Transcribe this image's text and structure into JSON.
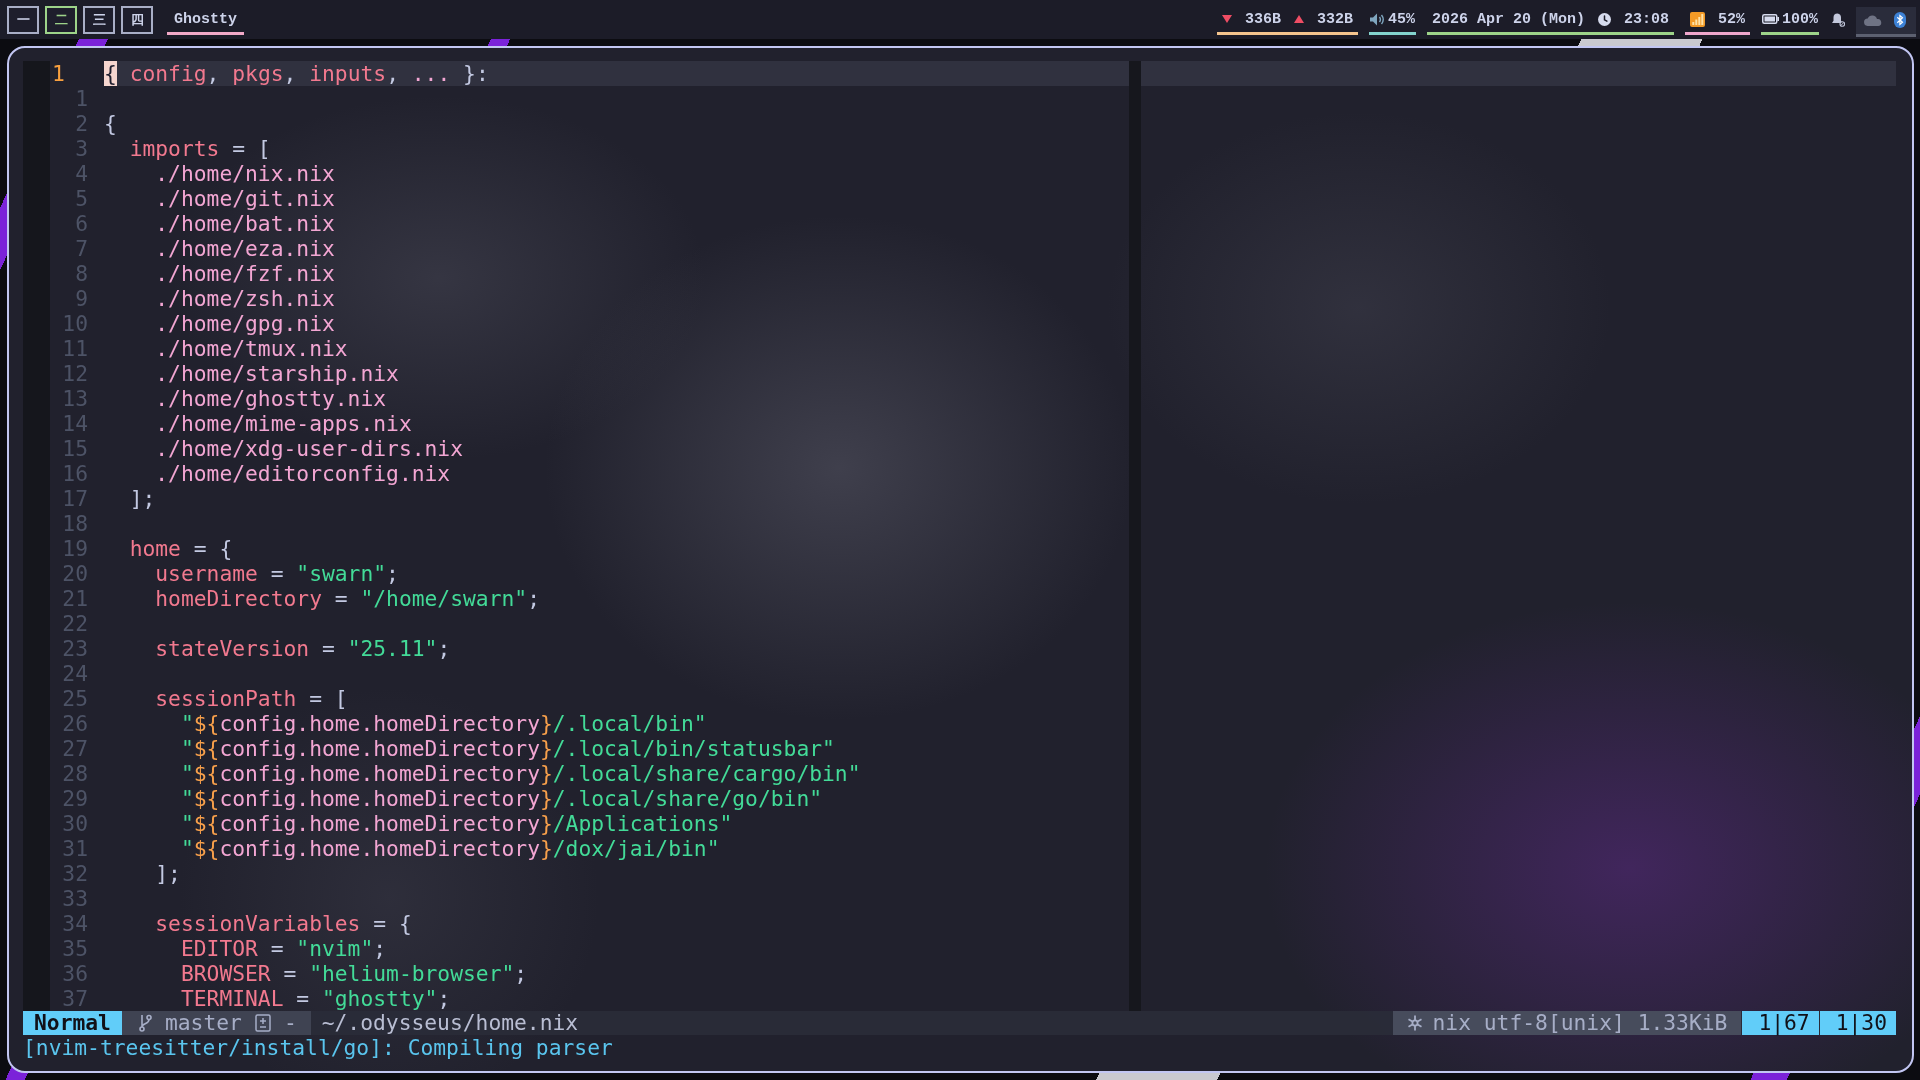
{
  "top_bar": {
    "workspaces": [
      {
        "label": "一",
        "selected": false
      },
      {
        "label": "二",
        "selected": true
      },
      {
        "label": "三",
        "selected": false
      },
      {
        "label": "四",
        "selected": false
      }
    ],
    "window_title": "Ghostty",
    "modules": [
      {
        "kind": "network",
        "down": "336B",
        "up": "332B",
        "color": "#f4c48e"
      },
      {
        "kind": "volume",
        "text": "45%",
        "color": "#83d3cd"
      },
      {
        "kind": "clock",
        "date": "2026 Apr 20 (Mon)",
        "time": "23:08",
        "color": "#9dd389"
      },
      {
        "kind": "signal",
        "text": "52%",
        "color": "#efa6cc"
      },
      {
        "kind": "battery",
        "text": "100%",
        "color": "#9dd389"
      },
      {
        "kind": "notifications"
      },
      {
        "kind": "tray"
      }
    ]
  },
  "editor": {
    "lines": [
      {
        "number": "1",
        "current": true,
        "tokens": [
          {
            "kind": "cursor",
            "text": "{"
          },
          {
            "kind": "attribute",
            "text": " config"
          },
          {
            "kind": "punctuation",
            "text": ", "
          },
          {
            "kind": "attribute",
            "text": "pkgs"
          },
          {
            "kind": "punctuation",
            "text": ", "
          },
          {
            "kind": "attribute",
            "text": "inputs"
          },
          {
            "kind": "punctuation",
            "text": ", "
          },
          {
            "kind": "variable",
            "text": "..."
          },
          {
            "kind": "punctuation",
            "text": " }:"
          }
        ]
      },
      {
        "number": "1",
        "current": false
      },
      {
        "number": "2",
        "current": false,
        "tokens": [
          {
            "kind": "punctuation",
            "text": "{"
          }
        ],
        "children": [
          {
            "number": "3",
            "current": false,
            "tokens": [
              {
                "kind": "attribute",
                "text": "imports"
              },
              {
                "kind": "punctuation",
                "text": " = ["
              }
            ],
            "children": [
              {
                "number": "4",
                "current": false,
                "tokens": [
                  {
                    "kind": "path",
                    "text": "./home/nix.nix"
                  }
                ]
              },
              {
                "number": "5",
                "current": false,
                "tokens": [
                  {
                    "kind": "path",
                    "text": "./home/git.nix"
                  }
                ]
              },
              {
                "number": "6",
                "current": false,
                "tokens": [
                  {
                    "kind": "path",
                    "text": "./home/bat.nix"
                  }
                ]
              },
              {
                "number": "7",
                "current": false,
                "tokens": [
                  {
                    "kind": "path",
                    "text": "./home/eza.nix"
                  }
                ]
              },
              {
                "number": "8",
                "current": false,
                "tokens": [
                  {
                    "kind": "path",
                    "text": "./home/fzf.nix"
                  }
                ]
              },
              {
                "number": "9",
                "current": false,
                "tokens": [
                  {
                    "kind": "path",
                    "text": "./home/zsh.nix"
                  }
                ]
              },
              {
                "number": "10",
                "current": false,
                "tokens": [
                  {
                    "kind": "path",
                    "text": "./home/gpg.nix"
                  }
                ]
              },
              {
                "number": "11",
                "current": false,
                "tokens": [
                  {
                    "kind": "path",
                    "text": "./home/tmux.nix"
                  }
                ]
              },
              {
                "number": "12",
                "current": false,
                "tokens": [
                  {
                    "kind": "path",
                    "text": "./home/starship.nix"
                  }
                ]
              },
              {
                "number": "13",
                "current": false,
                "tokens": [
                  {
                    "kind": "path",
                    "text": "./home/ghostty.nix"
                  }
                ]
              },
              {
                "number": "14",
                "current": false,
                "tokens": [
                  {
                    "kind": "path",
                    "text": "./home/mime-apps.nix"
                  }
                ]
              },
              {
                "number": "15",
                "current": false,
                "tokens": [
                  {
                    "kind": "path",
                    "text": "./home/xdg-user-dirs.nix"
                  }
                ]
              },
              {
                "number": "16",
                "current": false,
                "tokens": [
                  {
                    "kind": "path",
                    "text": "./home/editorconfig.nix"
                  }
                ]
              }
            ]
          },
          {
            "number": "17",
            "current": false,
            "tokens": [
              {
                "kind": "punctuation",
                "text": "];"
              }
            ]
          },
          {
            "number": "18",
            "current": false
          },
          {
            "number": "19",
            "current": false,
            "tokens": [
              {
                "kind": "attribute",
                "text": "home"
              },
              {
                "kind": "punctuation",
                "text": " = {"
              }
            ],
            "children": [
              {
                "number": "20",
                "current": false,
                "tokens": [
                  {
                    "kind": "attribute",
                    "text": "username"
                  },
                  {
                    "kind": "punctuation",
                    "text": " = "
                  },
                  {
                    "kind": "string",
                    "text": "\"swarn\""
                  },
                  {
                    "kind": "punctuation",
                    "text": ";"
                  }
                ]
              },
              {
                "number": "21",
                "current": false,
                "tokens": [
                  {
                    "kind": "attribute",
                    "text": "homeDirectory"
                  },
                  {
                    "kind": "punctuation",
                    "text": " = "
                  },
                  {
                    "kind": "string",
                    "text": "\"/home/swarn\""
                  },
                  {
                    "kind": "punctuation",
                    "text": ";"
                  }
                ]
              },
              {
                "number": "22",
                "current": false
              },
              {
                "number": "23",
                "current": false,
                "tokens": [
                  {
                    "kind": "attribute",
                    "text": "stateVersion"
                  },
                  {
                    "kind": "punctuation",
                    "text": " = "
                  },
                  {
                    "kind": "string",
                    "text": "\"25.11\""
                  },
                  {
                    "kind": "punctuation",
                    "text": ";"
                  }
                ]
              },
              {
                "number": "24",
                "current": false
              },
              {
                "number": "25",
                "current": false,
                "tokens": [
                  {
                    "kind": "attribute",
                    "text": "sessionPath"
                  },
                  {
                    "kind": "punctuation",
                    "text": " = ["
                  }
                ],
                "children": [
                  {
                    "number": "26",
                    "current": false,
                    "tokens": [
                      {
                        "kind": "string",
                        "text": "\""
                      },
                      {
                        "kind": "interpolation",
                        "text": "${"
                      },
                      {
                        "kind": "variable",
                        "text": "config.home.homeDirectory"
                      },
                      {
                        "kind": "interpolation",
                        "text": "}"
                      },
                      {
                        "kind": "string",
                        "text": "/.local/bin\""
                      }
                    ]
                  },
                  {
                    "number": "27",
                    "current": false,
                    "tokens": [
                      {
                        "kind": "string",
                        "text": "\""
                      },
                      {
                        "kind": "interpolation",
                        "text": "${"
                      },
                      {
                        "kind": "variable",
                        "text": "config.home.homeDirectory"
                      },
                      {
                        "kind": "interpolation",
                        "text": "}"
                      },
                      {
                        "kind": "string",
                        "text": "/.local/bin/statusbar\""
                      }
                    ]
                  },
                  {
                    "number": "28",
                    "current": false,
                    "tokens": [
                      {
                        "kind": "string",
                        "text": "\""
                      },
                      {
                        "kind": "interpolation",
                        "text": "${"
                      },
                      {
                        "kind": "variable",
                        "text": "config.home.homeDirectory"
                      },
                      {
                        "kind": "interpolation",
                        "text": "}"
                      },
                      {
                        "kind": "string",
                        "text": "/.local/share/cargo/bin\""
                      }
                    ]
                  },
                  {
                    "number": "29",
                    "current": false,
                    "tokens": [
                      {
                        "kind": "string",
                        "text": "\""
                      },
                      {
                        "kind": "interpolation",
                        "text": "${"
                      },
                      {
                        "kind": "variable",
                        "text": "config.home.homeDirectory"
                      },
                      {
                        "kind": "interpolation",
                        "text": "}"
                      },
                      {
                        "kind": "string",
                        "text": "/.local/share/go/bin\""
                      }
                    ]
                  },
                  {
                    "number": "30",
                    "current": false,
                    "tokens": [
                      {
                        "kind": "string",
                        "text": "\""
                      },
                      {
                        "kind": "interpolation",
                        "text": "${"
                      },
                      {
                        "kind": "variable",
                        "text": "config.home.homeDirectory"
                      },
                      {
                        "kind": "interpolation",
                        "text": "}"
                      },
                      {
                        "kind": "string",
                        "text": "/Applications\""
                      }
                    ]
                  },
                  {
                    "number": "31",
                    "current": false,
                    "tokens": [
                      {
                        "kind": "string",
                        "text": "\""
                      },
                      {
                        "kind": "interpolation",
                        "text": "${"
                      },
                      {
                        "kind": "variable",
                        "text": "config.home.homeDirectory"
                      },
                      {
                        "kind": "interpolation",
                        "text": "}"
                      },
                      {
                        "kind": "string",
                        "text": "/dox/jai/bin\""
                      }
                    ]
                  }
                ]
              },
              {
                "number": "32",
                "current": false,
                "tokens": [
                  {
                    "kind": "punctuation",
                    "text": "];"
                  }
                ]
              },
              {
                "number": "33",
                "current": false
              },
              {
                "number": "34",
                "current": false,
                "tokens": [
                  {
                    "kind": "attribute",
                    "text": "sessionVariables"
                  },
                  {
                    "kind": "punctuation",
                    "text": " = {"
                  }
                ],
                "children": [
                  {
                    "number": "35",
                    "current": false,
                    "tokens": [
                      {
                        "kind": "attribute",
                        "text": "EDITOR"
                      },
                      {
                        "kind": "punctuation",
                        "text": " = "
                      },
                      {
                        "kind": "string",
                        "text": "\"nvim\""
                      },
                      {
                        "kind": "punctuation",
                        "text": ";"
                      }
                    ]
                  },
                  {
                    "number": "36",
                    "current": false,
                    "tokens": [
                      {
                        "kind": "attribute",
                        "text": "BROWSER"
                      },
                      {
                        "kind": "punctuation",
                        "text": " = "
                      },
                      {
                        "kind": "string",
                        "text": "\"helium-browser\""
                      },
                      {
                        "kind": "punctuation",
                        "text": ";"
                      }
                    ]
                  },
                  {
                    "number": "37",
                    "current": false,
                    "tokens": [
                      {
                        "kind": "attribute",
                        "text": "TERMINAL"
                      },
                      {
                        "kind": "punctuation",
                        "text": " = "
                      },
                      {
                        "kind": "string",
                        "text": "\"ghostty\""
                      },
                      {
                        "kind": "punctuation",
                        "text": ";"
                      }
                    ]
                  }
                ]
              }
            ]
          }
        ]
      }
    ],
    "split_pane": {
      "cursor_line": true
    }
  },
  "status_line": {
    "mode": "Normal",
    "branch": "master",
    "diff": "-",
    "file": "~/.odysseus/home.nix",
    "filetype": "nix",
    "encoding": "utf-8[unix]",
    "size": "1.33KiB",
    "positions": [
      "1|67",
      "1|30"
    ]
  },
  "command_line": {
    "message": "[nvim-treesitter/install/go]: Compiling parser"
  }
}
